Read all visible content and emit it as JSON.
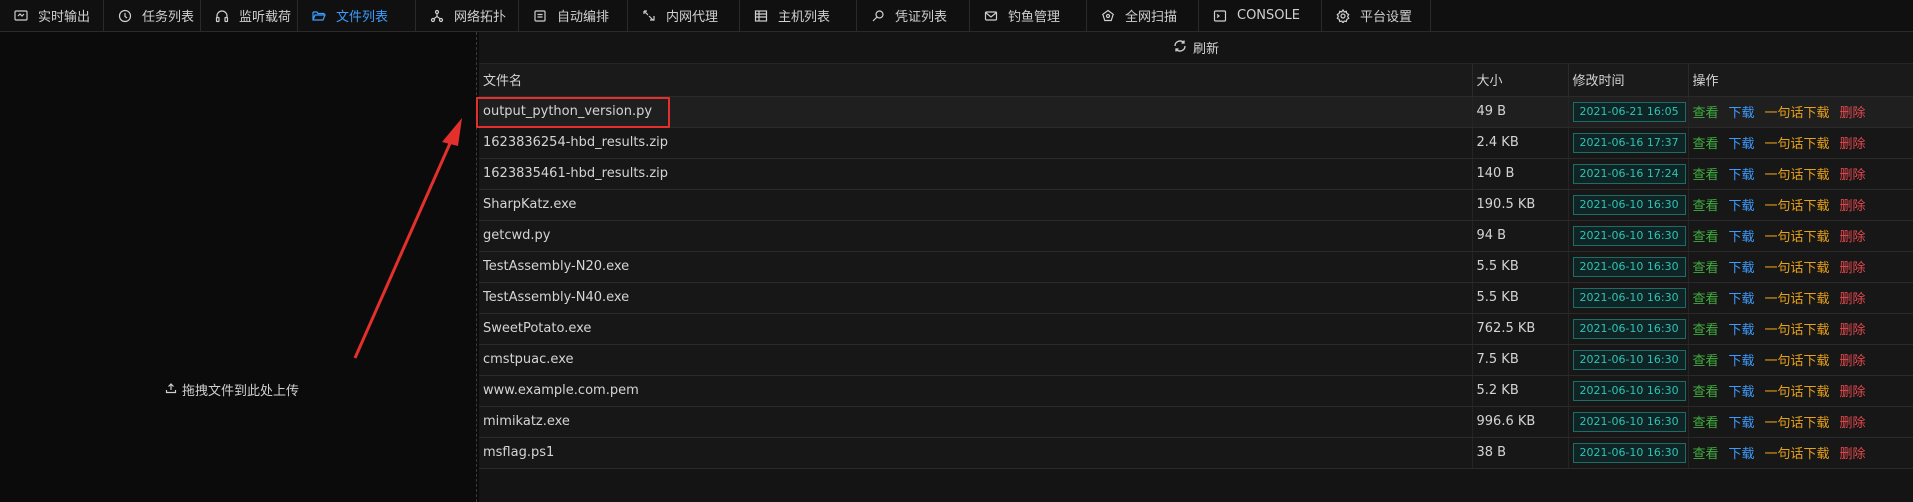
{
  "nav": {
    "tabs": [
      {
        "label": "实时输出",
        "icon": "monitor-icon",
        "active": false
      },
      {
        "label": "任务列表",
        "icon": "clock-icon",
        "active": false
      },
      {
        "label": "监听载荷",
        "icon": "headphones-icon",
        "active": false
      },
      {
        "label": "文件列表",
        "icon": "folder-open-icon",
        "active": true
      },
      {
        "label": "网络拓扑",
        "icon": "network-icon",
        "active": false
      },
      {
        "label": "自动编排",
        "icon": "calendar-icon",
        "active": false
      },
      {
        "label": "内网代理",
        "icon": "proxy-icon",
        "active": false
      },
      {
        "label": "主机列表",
        "icon": "table-icon",
        "active": false
      },
      {
        "label": "凭证列表",
        "icon": "key-icon",
        "active": false
      },
      {
        "label": "钓鱼管理",
        "icon": "mail-icon",
        "active": false
      },
      {
        "label": "全网扫描",
        "icon": "radar-icon",
        "active": false
      },
      {
        "label": "CONSOLE",
        "icon": "code-icon",
        "active": false
      },
      {
        "label": "平台设置",
        "icon": "gear-icon",
        "active": false
      }
    ]
  },
  "upload": {
    "hint": "拖拽文件到此处上传"
  },
  "toolbar": {
    "refresh_label": "刷新"
  },
  "table": {
    "headers": {
      "name": "文件名",
      "size": "大小",
      "mtime": "修改时间",
      "ops": "操作"
    },
    "actions": {
      "view": "查看",
      "download": "下载",
      "one_liner": "一句话下载",
      "delete": "删除"
    },
    "rows": [
      {
        "name": "output_python_version.py",
        "size": "49 B",
        "mtime": "2021-06-21 16:05"
      },
      {
        "name": "1623836254-hbd_results.zip",
        "size": "2.4 KB",
        "mtime": "2021-06-16 17:37"
      },
      {
        "name": "1623835461-hbd_results.zip",
        "size": "140 B",
        "mtime": "2021-06-16 17:24"
      },
      {
        "name": "SharpKatz.exe",
        "size": "190.5 KB",
        "mtime": "2021-06-10 16:30"
      },
      {
        "name": "getcwd.py",
        "size": "94 B",
        "mtime": "2021-06-10 16:30"
      },
      {
        "name": "TestAssembly-N20.exe",
        "size": "5.5 KB",
        "mtime": "2021-06-10 16:30"
      },
      {
        "name": "TestAssembly-N40.exe",
        "size": "5.5 KB",
        "mtime": "2021-06-10 16:30"
      },
      {
        "name": "SweetPotato.exe",
        "size": "762.5 KB",
        "mtime": "2021-06-10 16:30"
      },
      {
        "name": "cmstpuac.exe",
        "size": "7.5 KB",
        "mtime": "2021-06-10 16:30"
      },
      {
        "name": "www.example.com.pem",
        "size": "5.2 KB",
        "mtime": "2021-06-10 16:30"
      },
      {
        "name": "mimikatz.exe",
        "size": "996.6 KB",
        "mtime": "2021-06-10 16:30"
      },
      {
        "name": "msflag.ps1",
        "size": "38 B",
        "mtime": "2021-06-10 16:30"
      }
    ]
  },
  "colors": {
    "accent": "#3c9cff",
    "view": "#3fae3f",
    "download": "#3c9cff",
    "one_liner": "#e7a11a",
    "delete": "#e5484d",
    "time_badge": "#2ec2b6",
    "annotation": "#e4302d"
  }
}
